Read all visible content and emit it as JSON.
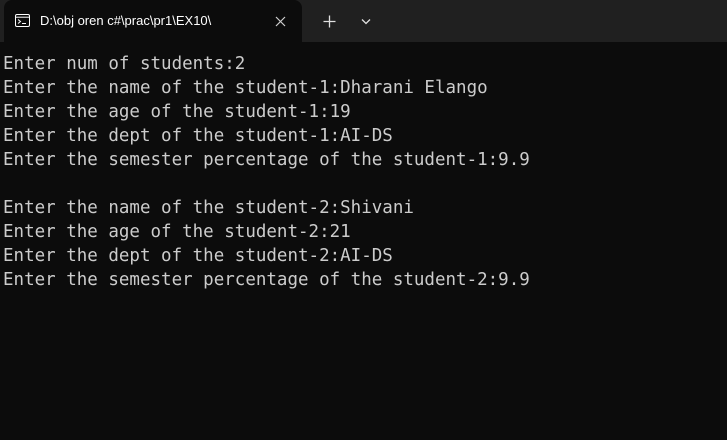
{
  "window": {
    "tab_title": "D:\\obj oren c#\\prac\\pr1\\EX10\\",
    "tab_icon": "console-app-icon",
    "close_icon": "close-icon",
    "new_tab_icon": "plus-icon",
    "dropdown_icon": "chevron-down-icon"
  },
  "terminal": {
    "lines": [
      "Enter num of students:2",
      "Enter the name of the student-1:Dharani Elango",
      "Enter the age of the student-1:19",
      "Enter the dept of the student-1:AI-DS",
      "Enter the semester percentage of the student-1:9.9",
      "",
      "Enter the name of the student-2:Shivani",
      "Enter the age of the student-2:21",
      "Enter the dept of the student-2:AI-DS",
      "Enter the semester percentage of the student-2:9.9"
    ]
  },
  "colors": {
    "background": "#0c0c0c",
    "tabbar": "#202020",
    "text": "#cccccc"
  }
}
